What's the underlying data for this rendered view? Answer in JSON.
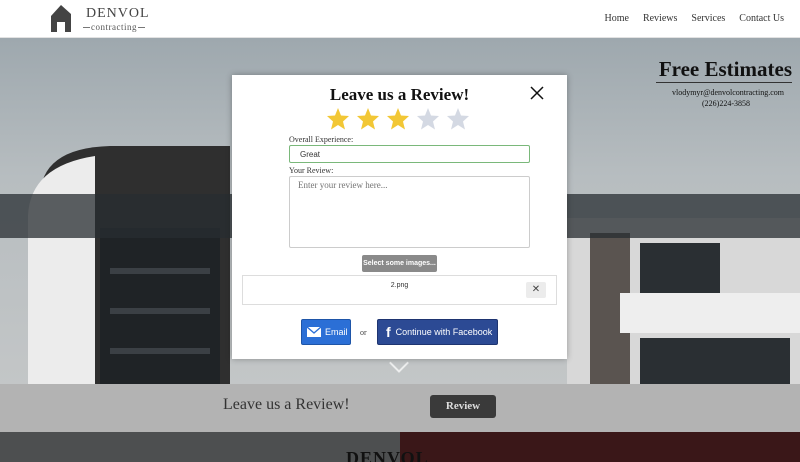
{
  "header": {
    "brand_name": "DENVOL",
    "brand_sub": "contracting",
    "nav": [
      "Home",
      "Reviews",
      "Services",
      "Contact Us"
    ]
  },
  "hero": {
    "title": "Free Estimates",
    "email": "vlodymyr@denvolcontracting.com",
    "phone": "(226)224-3858"
  },
  "review_strip": {
    "text": "Leave us a Review!",
    "button": "Review"
  },
  "bottom": {
    "brand": "DENVOL"
  },
  "modal": {
    "title": "Leave us a Review!",
    "rating": 3,
    "max_rating": 5,
    "star_colors": {
      "filled": "#f2c735",
      "empty": "#d4d9e3"
    },
    "overall_label": "Overall Experience:",
    "overall_value": "Great",
    "review_label": "Your Review:",
    "review_placeholder": "Enter your review here...",
    "select_images": "Select some images...",
    "file_name": "2.png",
    "email_button": "Email",
    "or": "or",
    "fb_button": "Continue with Facebook"
  }
}
